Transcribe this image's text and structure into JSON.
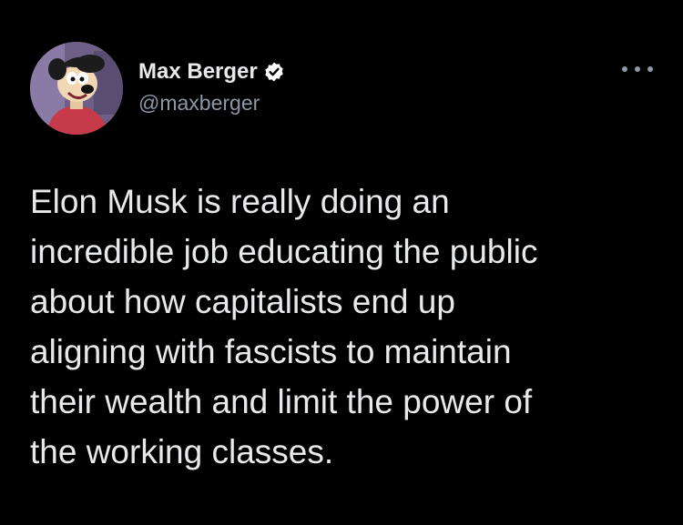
{
  "tweet": {
    "author": {
      "display_name": "Max Berger",
      "handle": "@maxberger",
      "verified": true,
      "avatar_icon": "cartoon-avatar-icon"
    },
    "more_icon": "more-options-icon",
    "text_lines": [
      "Elon Musk is really doing an",
      "incredible job educating the public",
      "about how capitalists end up",
      "aligning with fascists to maintain",
      "their wealth and limit the power of",
      "the working classes."
    ]
  },
  "colors": {
    "background": "#000000",
    "text_primary": "#e7e9ea",
    "text_secondary": "#8b98a5",
    "verified_badge": "#ffffff"
  }
}
